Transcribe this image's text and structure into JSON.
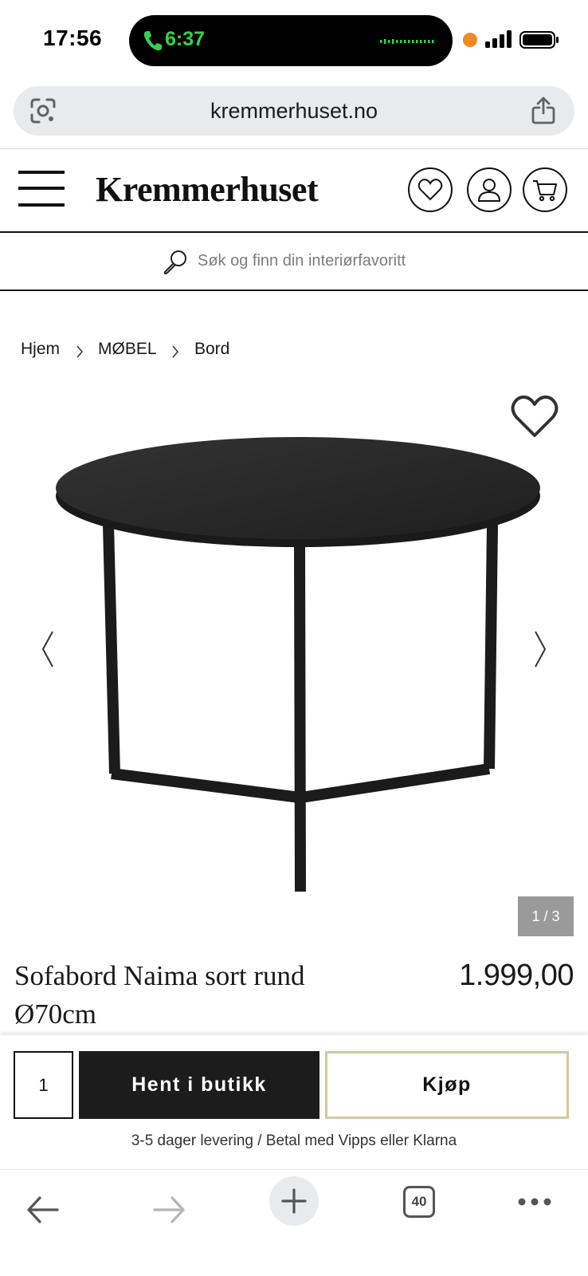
{
  "status_bar": {
    "time": "17:56",
    "call_time": "6:37"
  },
  "browser": {
    "url": "kremmerhuset.no",
    "tab_count": "40"
  },
  "site": {
    "logo": "Kremmerhuset",
    "search_placeholder": "Søk og finn din interiørfavoritt"
  },
  "breadcrumb": [
    "Hjem",
    "MØBEL",
    "Bord"
  ],
  "product": {
    "title": "Sofabord Naima sort rund Ø70cm",
    "price": "1.999,00",
    "image_counter": "1 / 3",
    "quantity": "1"
  },
  "purchase": {
    "pickup_label": "Hent i butikk",
    "buy_label": "Kjøp",
    "delivery_info": "3-5 dager levering / Betal med Vipps eller Klarna"
  },
  "icons": {
    "call": "phone-icon",
    "lens": "google-lens-icon",
    "share": "share-icon",
    "menu": "hamburger-menu-icon",
    "wishlist": "heart-icon",
    "account": "user-icon",
    "cart": "cart-icon",
    "search": "search-icon",
    "prev": "chevron-left-icon",
    "next": "chevron-right-icon",
    "back": "arrow-left-icon",
    "forward": "arrow-right-icon",
    "new_tab": "plus-icon",
    "more": "more-dots-icon"
  },
  "colors": {
    "call_green": "#35d34a",
    "recording_orange": "#f08a24",
    "pickup_button": "#1c1c1c",
    "buy_button_border": "#d6c7a0",
    "image_counter_bg": "#9a9a9a",
    "url_bar_bg": "#e9eaec"
  }
}
